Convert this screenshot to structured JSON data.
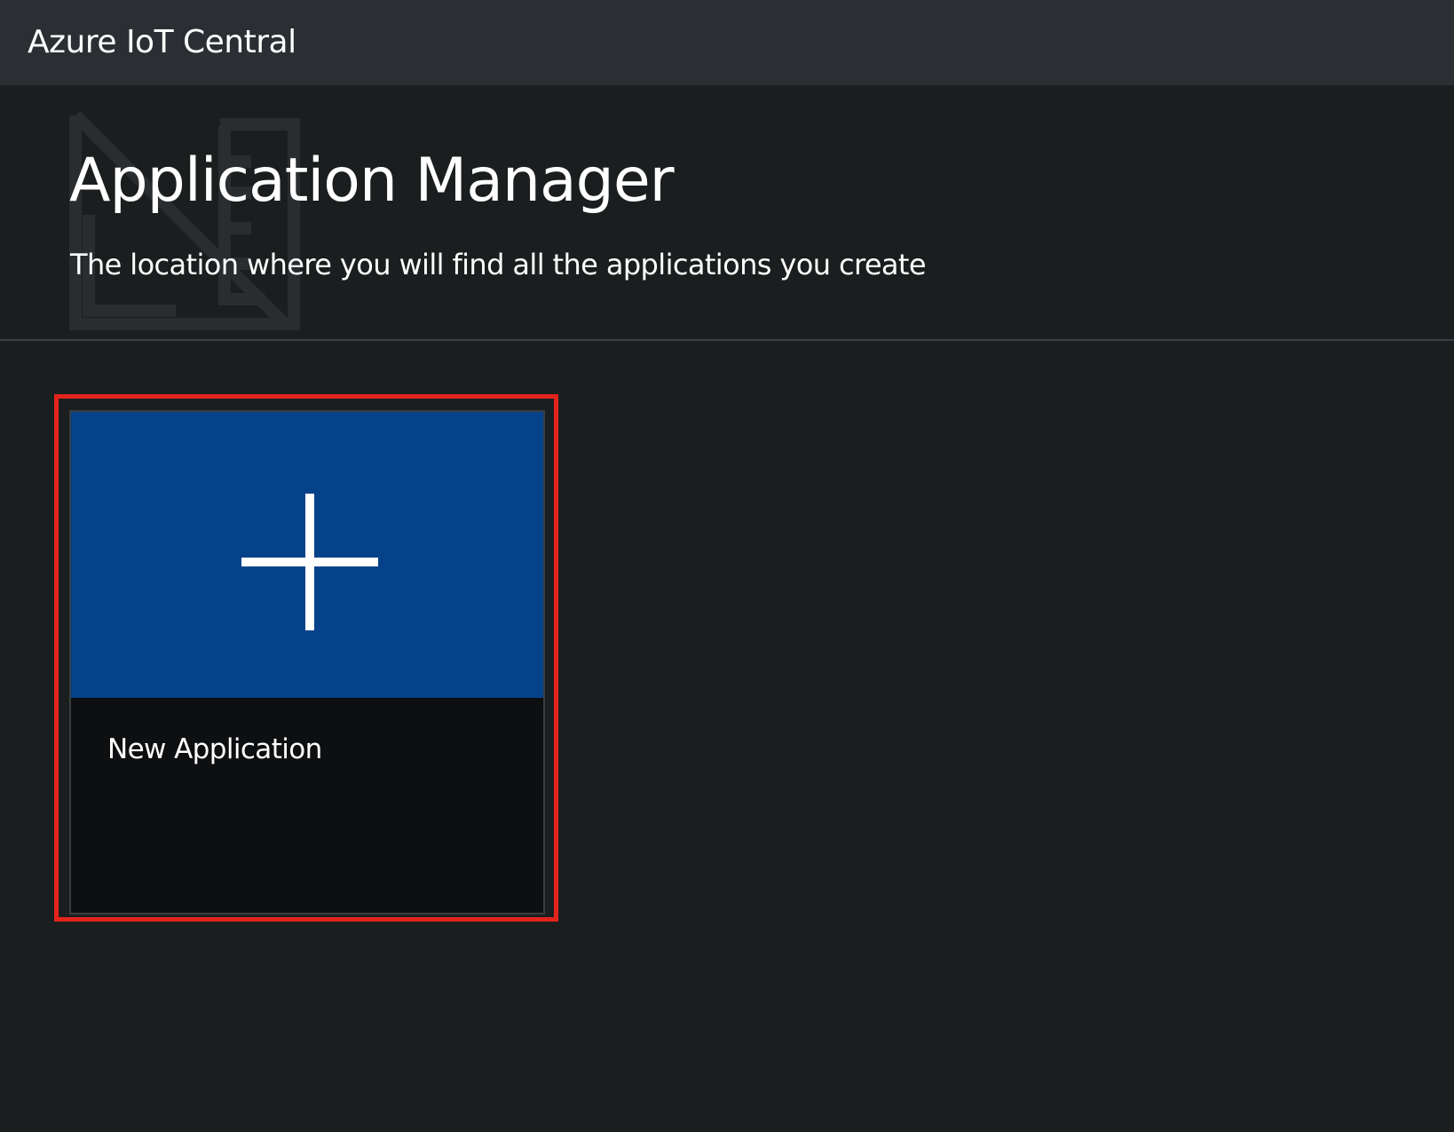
{
  "header": {
    "app_title": "Azure IoT Central"
  },
  "hero": {
    "title": "Application Manager",
    "subtitle": "The location where you will find all the applications you create",
    "watermark_icon": "application-manager-icon"
  },
  "tiles": [
    {
      "label": "New Application",
      "icon": "plus-icon",
      "banner_color": "#06428a",
      "highlighted": true
    }
  ],
  "colors": {
    "background": "#1b1e1f",
    "topbar": "#2b2e32",
    "tile_body": "#0e0f11",
    "highlight": "#e3241b"
  }
}
